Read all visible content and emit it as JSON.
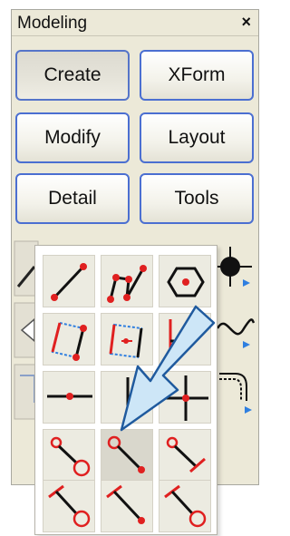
{
  "panel": {
    "title": "Modeling",
    "close_glyph": "×"
  },
  "buttons": [
    {
      "label": "Create"
    },
    {
      "label": "XForm"
    },
    {
      "label": "Modify"
    },
    {
      "label": "Layout"
    },
    {
      "label": "Detail"
    },
    {
      "label": "Tools"
    }
  ],
  "flyout_tools": [
    "line-icon",
    "polyline-icon",
    "polygon-icon",
    "rectangle-icon",
    "rotated-rectangle-icon",
    "rectangle-partial-icon",
    "node-icon",
    "tee-icon",
    "cross-icon",
    "line-ring-end-icon",
    "line-ring-start-icon",
    "line-bar-ring-icon",
    "line-bar-ring-left-icon",
    "line-bar-dot-icon",
    "line-bar-ring-right-icon"
  ],
  "colors": {
    "accent": "#4b6fd1",
    "red": "#e02020",
    "arrow_fill": "#cde6f7",
    "arrow_stroke": "#1f5a9e"
  }
}
